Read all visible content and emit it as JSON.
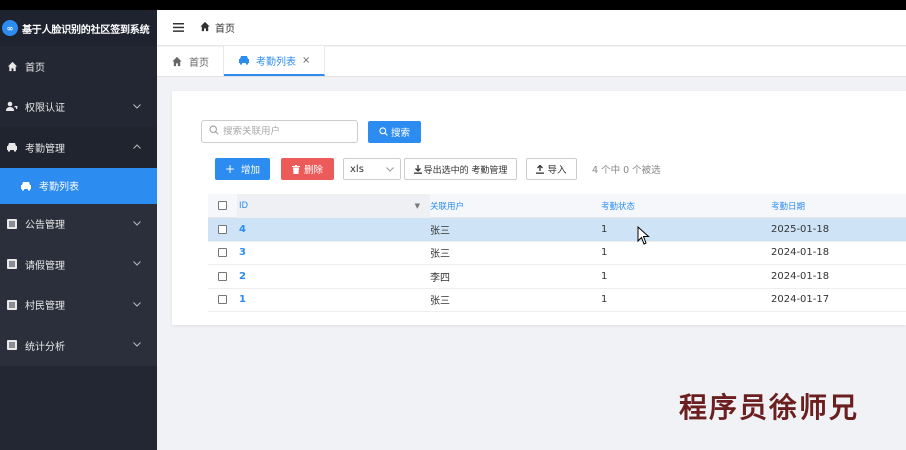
{
  "app": {
    "title": "基于人脸识别的社区签到系统",
    "logo_text": "∞"
  },
  "sidebar": {
    "items": [
      {
        "label": "首页",
        "icon": "home-icon"
      },
      {
        "label": "权限认证",
        "icon": "user-key-icon"
      },
      {
        "label": "考勤管理",
        "icon": "car-icon"
      },
      {
        "label": "公告管理",
        "icon": "list-icon"
      },
      {
        "label": "请假管理",
        "icon": "list-icon"
      },
      {
        "label": "村民管理",
        "icon": "list-icon"
      },
      {
        "label": "统计分析",
        "icon": "list-icon"
      }
    ],
    "subitem": {
      "label": "考勤列表",
      "icon": "car-icon"
    }
  },
  "header": {
    "breadcrumb": "首页"
  },
  "tabs": [
    {
      "label": "首页"
    },
    {
      "label": "考勤列表",
      "close": "×"
    }
  ],
  "search": {
    "placeholder": "搜索关联用户",
    "button_label": "搜索"
  },
  "toolbar": {
    "add_label": "增加",
    "delete_label": "删除",
    "format_value": "xls",
    "export_label": "导出选中的 考勤管理",
    "import_label": "导入",
    "selection_text": "4 个中 0 个被选"
  },
  "table": {
    "columns": [
      "ID",
      "关联用户",
      "考勤状态",
      "考勤日期"
    ],
    "rows": [
      {
        "id": "4",
        "user": "张三",
        "status": "1",
        "date": "2025-01-18"
      },
      {
        "id": "3",
        "user": "张三",
        "status": "1",
        "date": "2024-01-18"
      },
      {
        "id": "2",
        "user": "李四",
        "status": "1",
        "date": "2024-01-18"
      },
      {
        "id": "1",
        "user": "张三",
        "status": "1",
        "date": "2024-01-17"
      }
    ]
  },
  "watermark": "程序员徐师兄",
  "colors": {
    "primary": "#2d8cf0",
    "danger": "#ed5a5a",
    "sidebar_bg": "#232733",
    "row_highlight": "#cfe3f7"
  }
}
